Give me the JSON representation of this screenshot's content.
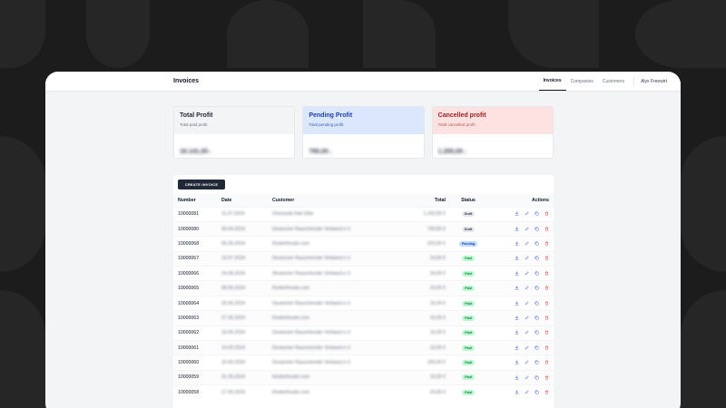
{
  "app": {
    "title": "Invoices",
    "user": "Alyx Freewirt"
  },
  "nav": {
    "tabs": [
      "Invoices",
      "Companies",
      "Customers"
    ],
    "active": "Invoices"
  },
  "cards": [
    {
      "title": "Total Profit",
      "subtitle": "Total paid profit",
      "value": "16.141,00",
      "currency": "€"
    },
    {
      "title": "Pending Profit",
      "subtitle": "Total pending profit",
      "value": "790,00",
      "currency": "€"
    },
    {
      "title": "Cancelled profit",
      "subtitle": "Total cancelled profit",
      "value": "1.200,00",
      "currency": "€"
    }
  ],
  "toolbar": {
    "create_label": "CREATE INVOICE"
  },
  "table": {
    "headers": {
      "number": "Number",
      "date": "Date",
      "customer": "Customer",
      "total": "Total",
      "status": "Status",
      "actions": "Actions"
    },
    "rows": [
      {
        "number": "10000081",
        "date": "11.07.2024",
        "customer": "Ostrowski Hair Elbe",
        "total": "1.150,00 €",
        "status": "Draft"
      },
      {
        "number": "10000080",
        "date": "30.04.2024",
        "customer": "Deutscher Rauschender Verband e.V.",
        "total": "790,00 €",
        "status": "Draft"
      },
      {
        "number": "10000068",
        "date": "05.05.2024",
        "customer": "Kinderfreude.com",
        "total": "220,00 €",
        "status": "Pending"
      },
      {
        "number": "10000067",
        "date": "10.07.2024",
        "customer": "Deutscher Rauschender Verband e.V.",
        "total": "24,00 €",
        "status": "Paid"
      },
      {
        "number": "10000066",
        "date": "24.06.2024",
        "customer": "Deutscher Rauschender Verband e.V.",
        "total": "24,00 €",
        "status": "Paid"
      },
      {
        "number": "10000065",
        "date": "08.06.2024",
        "customer": "Kinderfreude.com",
        "total": "24,00 €",
        "status": "Paid"
      },
      {
        "number": "10000064",
        "date": "20.06.2024",
        "customer": "Deutscher Rauschender Verband e.V.",
        "total": "15,00 €",
        "status": "Paid"
      },
      {
        "number": "10000063",
        "date": "27.06.2024",
        "customer": "Kinderfreude.com",
        "total": "15,00 €",
        "status": "Paid"
      },
      {
        "number": "10000062",
        "date": "19.06.2024",
        "customer": "Deutscher Rauschender Verband e.V.",
        "total": "15,00 €",
        "status": "Paid"
      },
      {
        "number": "10000061",
        "date": "14.05.2024",
        "customer": "Deutscher Rauschender Verband e.V.",
        "total": "15,00 €",
        "status": "Paid"
      },
      {
        "number": "10000060",
        "date": "15.05.2024",
        "customer": "Deutscher Rauschender Verband e.V.",
        "total": "100,00 €",
        "status": "Paid"
      },
      {
        "number": "10000059",
        "date": "31.05.2024",
        "customer": "Kinderfreude.com",
        "total": "15,00 €",
        "status": "Paid"
      },
      {
        "number": "10000058",
        "date": "17.05.2024",
        "customer": "Kinderfreude.com",
        "total": "24,00 €",
        "status": "Paid"
      }
    ]
  },
  "row_actions": [
    "download-icon",
    "edit-icon",
    "duplicate-icon",
    "delete-icon"
  ],
  "colors": {
    "accent": "#1f2937",
    "action_icon": "#4f6bd8",
    "delete_icon": "#ef4444",
    "draft": "#e5e7eb",
    "pending": "#bfdbfe",
    "paid": "#bbf7d0"
  }
}
